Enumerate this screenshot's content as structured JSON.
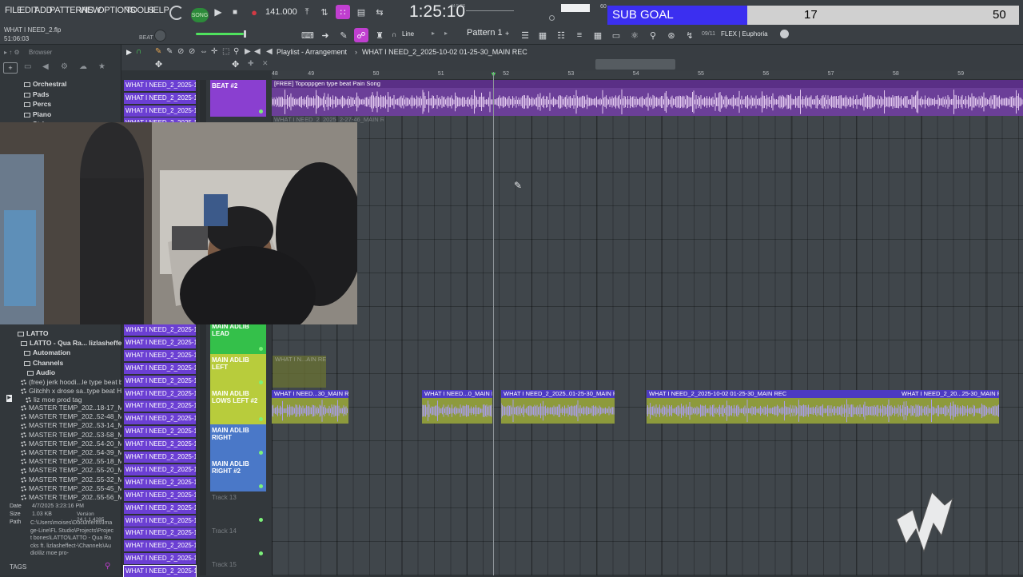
{
  "menu": [
    "FILE",
    "EDIT",
    "ADD",
    "PATTERNS",
    "VIEW",
    "OPTIONS",
    "TOOLS",
    "HELP"
  ],
  "project": {
    "file": "WHAT I NEED_2.flp",
    "time_code": "51:06:03",
    "beat_label": "BEAT"
  },
  "transport": {
    "song_label": "SONG",
    "tempo": "141.000",
    "time_display": "1:25:10",
    "msc_label": "M:S:CS",
    "pattern": "Pattern 1",
    "snap": "Line",
    "cpu_value": "60"
  },
  "sub_goal": {
    "label": "SUB GOAL",
    "current": "17",
    "target": "50",
    "progress": 0.34,
    "fill_color": "#3b2ff0"
  },
  "plugin_hint": {
    "counter": "09/11",
    "preset": "FLEX | Euphoria"
  },
  "browser": {
    "title": "Browser",
    "top_items": [
      "Orchestral",
      "Pads",
      "Percs",
      "Piano",
      "Strings"
    ],
    "tree": [
      "LATTO",
      "LATTO - Qua Ra... lizlasheffect",
      "Automation",
      "Channels",
      "Audio"
    ],
    "files": [
      "(free) jerk hoodi...le type beat bound",
      "Glitchh x drose sa..type beat HELP ME",
      "liz moe prod tag"
    ],
    "renders": [
      "MASTER TEMP_202..18-17_MAIN REC",
      "MASTER TEMP_202..52-48_MAIN REC",
      "MASTER TEMP_202..53-14_MAIN REC",
      "MASTER TEMP_202..53-58_MAIN REC",
      "MASTER TEMP_202..54-20_MAIN REC",
      "MASTER TEMP_202..54-39_MAIN REC",
      "MASTER TEMP_202..55-18_MAIN REC",
      "MASTER TEMP_202..55-20_MAIN REC",
      "MASTER TEMP_202..55-32_MAIN REC",
      "MASTER TEMP_202..55-45_MAIN REC",
      "MASTER TEMP_202..55-56_MAIN REC"
    ],
    "info": {
      "date_label": "Date",
      "date": "4/7/2025 3:23:16 PM",
      "size_label": "Size",
      "size": "1.03 KB",
      "version": "Version 24.1.1.4285",
      "path_label": "Path",
      "path": "C:\\Users\\moises\\Documents\\Image-Line\\FL Studio\\Projects\\Project bones\\LATTO\\LATTO - Qua Racks ft. lizlasheffect-\\Channels\\Audio\\liz moe pro-"
    },
    "tags_label": "TAGS"
  },
  "playlist": {
    "title": "Playlist - Arrangement",
    "breadcrumb": "WHAT I NEED_2_2025-10-02 01-25-30_MAIN REC",
    "bar_numbers": [
      "48",
      "49",
      "50",
      "51",
      "52",
      "53",
      "54",
      "55",
      "56",
      "57",
      "58",
      "59"
    ],
    "pattern_clip": "WHAT I NEED_2_2025-10...",
    "pattern_clip_count": 39,
    "tracks": [
      {
        "name": "BEAT #2",
        "color": "#8a3fd0"
      },
      {
        "name": "MAIN ADLIB LEAD",
        "color": "#34c04a"
      },
      {
        "name": "MAIN ADLIB LEFT",
        "color": "#b8cc3c"
      },
      {
        "name": "MAIN ADLIB LOWS LEFT #2",
        "color": "#b8cc3c"
      },
      {
        "name": "MAIN ADLIB RIGHT",
        "color": "#4a78c8"
      },
      {
        "name": "MAIN ADLIB RIGHT #2",
        "color": "#4a78c8"
      },
      {
        "name": "Track 13",
        "color": ""
      },
      {
        "name": "Track 14",
        "color": ""
      },
      {
        "name": "Track 15",
        "color": ""
      }
    ],
    "clips": {
      "beat": "[FREE] Topoppgen type beat  Pain Song",
      "beat_ghost": "WHAT I NEED_2_2025_2-27-46_MAIN REC",
      "adlib_left_ghost": "WHAT I N...AIN REC",
      "lows": [
        "WHAT I NEED...30_MAIN REC",
        "WHAT I NEED...0_MAIN REC",
        "WHAT I NEED_2_2025..01-25-30_MAIN REC",
        "WHAT I NEED_2_2025-10-02 01-25-30_MAIN REC",
        "WHAT I NEED_2_20...25-30_MAIN REC"
      ]
    }
  }
}
